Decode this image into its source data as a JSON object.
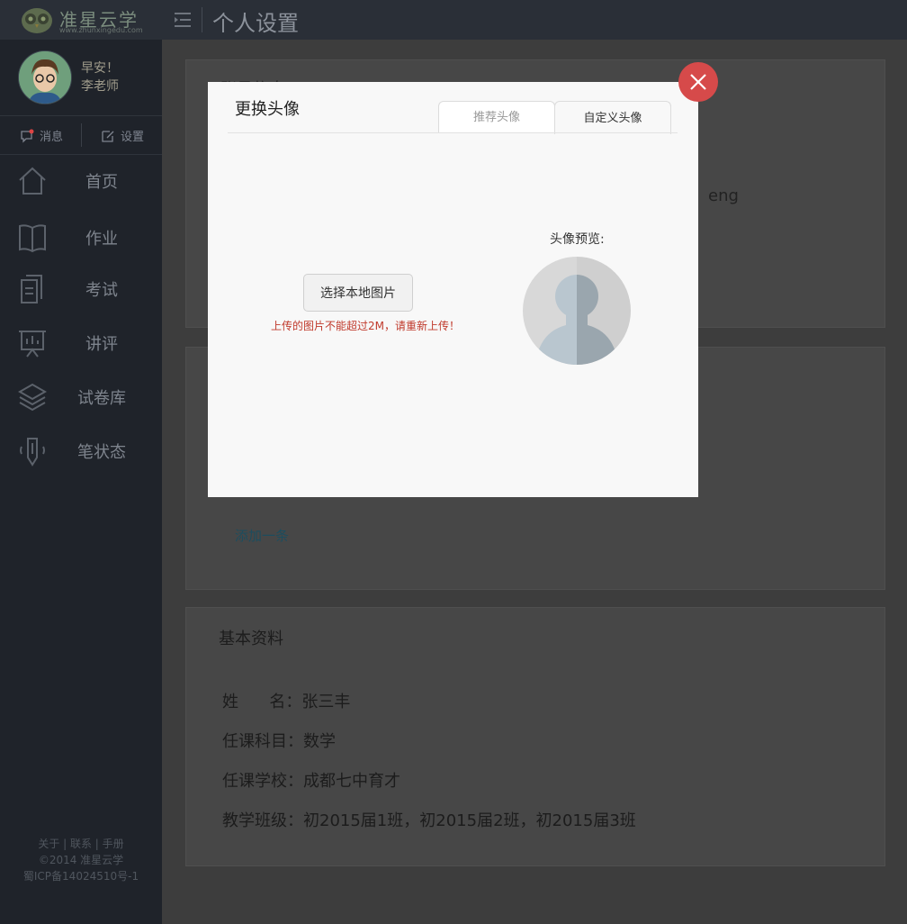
{
  "app": {
    "logo_title": "准星云学",
    "logo_url": "www.zhunxingedu.com",
    "page_title": "个人设置"
  },
  "user": {
    "greeting": "早安！",
    "name": "李老师"
  },
  "sidebar": {
    "messages_label": "消息",
    "settings_label": "设置",
    "items": [
      {
        "label": "首页",
        "icon": "home-icon"
      },
      {
        "label": "作业",
        "icon": "book-icon"
      },
      {
        "label": "考试",
        "icon": "document-icon"
      },
      {
        "label": "讲评",
        "icon": "presentation-board-icon"
      },
      {
        "label": "试卷库",
        "icon": "layers-icon"
      },
      {
        "label": "笔状态",
        "icon": "pen-icon"
      }
    ],
    "footer": {
      "links": "关于 | 联系 | 手册",
      "copyright": "©2014 准星云学",
      "icp": "蜀ICP备14024510号-1"
    }
  },
  "main": {
    "account_title": "账号信息",
    "account_text_fragment": "eng",
    "add_link": "添加一条",
    "basic_title": "基本资料",
    "basic_rows": [
      {
        "label": "姓 名",
        "value": "张三丰"
      },
      {
        "label": "任课科目",
        "value": "数学"
      },
      {
        "label": "任课学校",
        "value": "成都七中育才"
      },
      {
        "label": "教学班级",
        "value": "初2015届1班，初2015届2班，初2015届3班"
      }
    ]
  },
  "modal": {
    "title": "更换头像",
    "tab_recommended": "推荐头像",
    "tab_custom": "自定义头像",
    "choose_button": "选择本地图片",
    "error_tip": "上传的图片不能超过2M，请重新上传！",
    "preview_label": "头像预览:"
  }
}
